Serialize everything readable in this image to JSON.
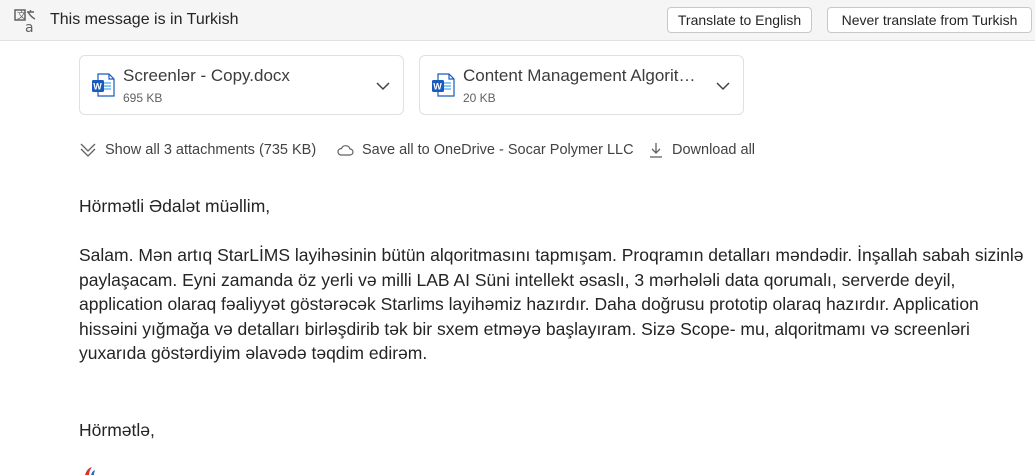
{
  "translation_bar": {
    "message": "This message is in Turkish",
    "translate_button": "Translate to English",
    "never_button": "Never translate from Turkish",
    "icon": "translate-icon"
  },
  "attachments": [
    {
      "name": "Screenlər - Copy.docx",
      "size": "695 KB",
      "icon": "word-doc-icon"
    },
    {
      "name": "Content Management Algorithm.docx",
      "size": "20 KB",
      "icon": "word-doc-icon"
    }
  ],
  "attachment_actions": {
    "show_all": "Show all 3 attachments (735 KB)",
    "save_all": "Save all to OneDrive - Socar Polymer LLC",
    "download_all": "Download all"
  },
  "message_body": {
    "greeting": "Hörmətli Ədalət müəllim,",
    "paragraph": "Salam. Mən artıq StarLİMS layihəsinin bütün alqoritmasını tapmışam. Proqramın detalları məndədir. İnşallah sabah sizinlə paylaşacam. Eyni zamanda öz yerli və milli LAB AI Süni intellekt əsaslı, 3 mərhələli data qorumalı, serverde deyil, application olaraq fəaliyyət göstərəcək Starlims layihəmiz hazırdır. Daha doğrusu prototip olaraq hazırdır. Application hissəini yığmağa və detalları birləşdirib tək bir sxem etməyə başlayıram. Sizə Scope- mu, alqoritmamı və screenləri yuxarıda göstərdiyim əlavədə təqdim edirəm.",
    "signoff": "Hörmətlə,"
  },
  "colors": {
    "bar_bg": "#f5f5f5",
    "word_blue": "#185abd",
    "text": "#242424"
  }
}
